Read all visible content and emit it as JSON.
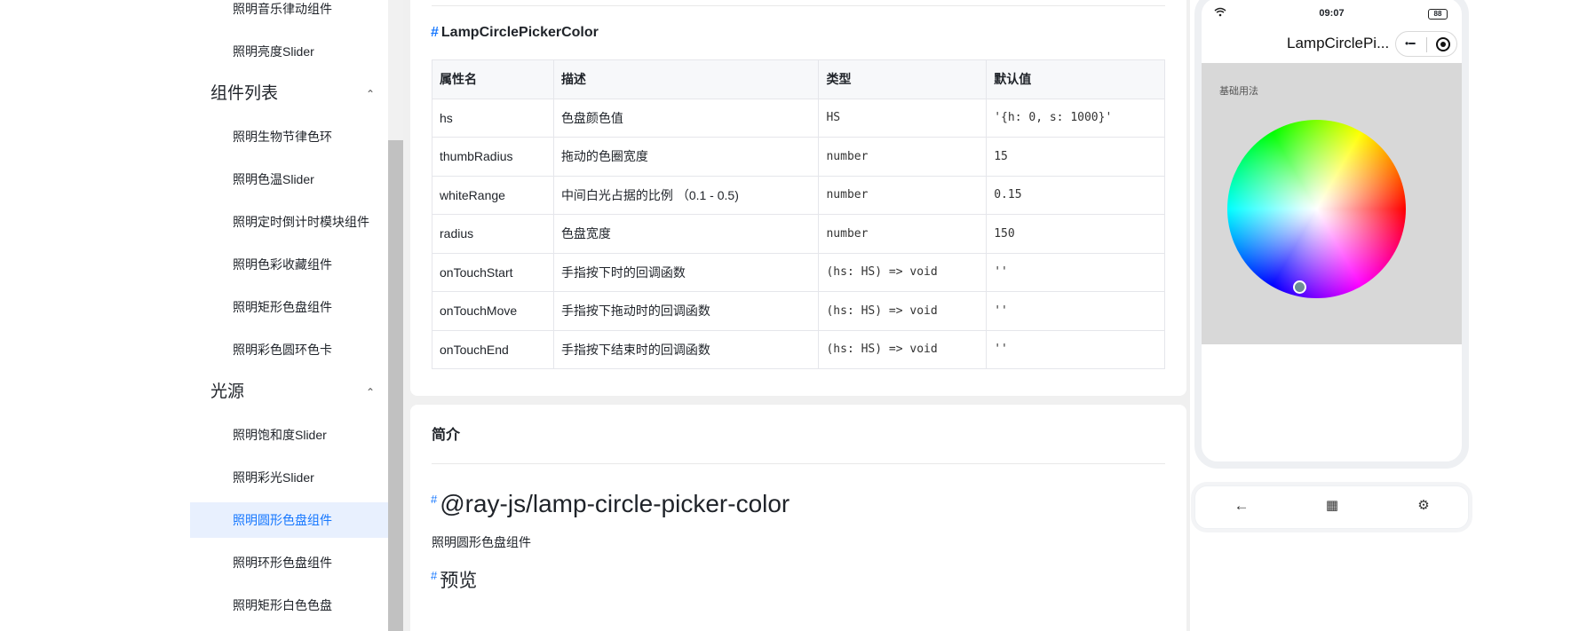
{
  "sidebar": {
    "items_top": [
      "照明音乐律动组件",
      "照明亮度Slider"
    ],
    "group1": "组件列表",
    "group1_items": [
      "照明生物节律色环",
      "照明色温Slider",
      "照明定时倒计时模块组件",
      "照明色彩收藏组件",
      "照明矩形色盘组件",
      "照明彩色圆环色卡"
    ],
    "group2": "光源",
    "group2_items": [
      "照明饱和度Slider",
      "照明彩光Slider",
      "照明圆形色盘组件",
      "照明环形色盘组件",
      "照明矩形白色色盘"
    ],
    "chevron": "⌃"
  },
  "main": {
    "api_heading": "LampCirclePickerColor",
    "hash": "#",
    "table": {
      "headers": [
        "属性名",
        "描述",
        "类型",
        "默认值"
      ],
      "rows": [
        [
          "hs",
          "色盘颜色值",
          "HS",
          "'{h: 0, s: 1000}'"
        ],
        [
          "thumbRadius",
          "拖动的色圈宽度",
          "number",
          "15"
        ],
        [
          "whiteRange",
          "中间白光占据的比例 （0.1 - 0.5)",
          "number",
          "0.15"
        ],
        [
          "radius",
          "色盘宽度",
          "number",
          "150"
        ],
        [
          "onTouchStart",
          "手指按下时的回调函数",
          "(hs: HS) => void",
          "''"
        ],
        [
          "onTouchMove",
          "手指按下拖动时的回调函数",
          "(hs: HS) => void",
          "''"
        ],
        [
          "onTouchEnd",
          "手指按下结束时的回调函数",
          "(hs: HS) => void",
          "''"
        ]
      ]
    },
    "intro": "简介",
    "package_title": "@ray-js/lamp-circle-picker-color",
    "package_desc": "照明圆形色盘组件",
    "preview_title": "预览"
  },
  "phone": {
    "time": "09:07",
    "battery": "88",
    "wifi_icon": "wifi-icon",
    "nav_title": "LampCirclePi...",
    "basic_label": "基础用法",
    "toolbar": {
      "back_icon": "←",
      "qr_icon": "▦",
      "settings_icon": "⚙"
    }
  }
}
